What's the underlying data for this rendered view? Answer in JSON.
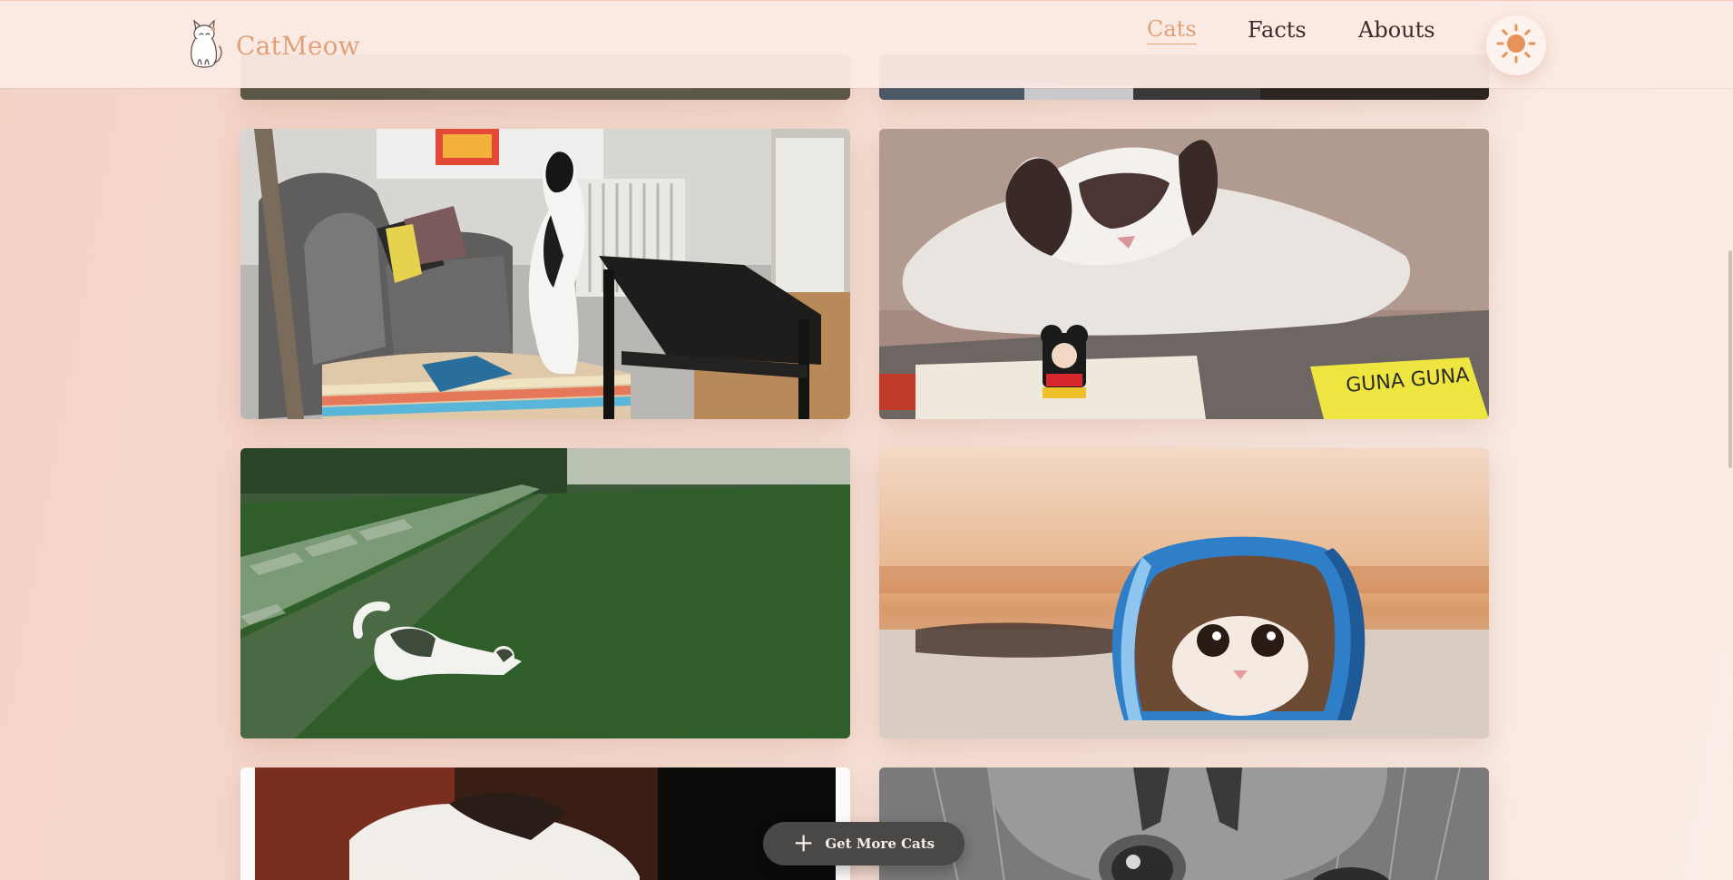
{
  "brand": {
    "name": "CatMeow",
    "logo_icon": "cat-icon"
  },
  "nav": {
    "items": [
      {
        "label": "Cats",
        "active": true
      },
      {
        "label": "Facts",
        "active": false
      },
      {
        "label": "Abouts",
        "active": false
      }
    ]
  },
  "theme_toggle": {
    "icon": "sun-icon"
  },
  "gallery": {
    "photos": [
      {
        "subject": "cat-photo"
      },
      {
        "subject": "cat-photo"
      },
      {
        "subject": "cat-standing-in-living-room"
      },
      {
        "subject": "fluffy-cat-lying-on-table"
      },
      {
        "subject": "cat-stretching-on-grass"
      },
      {
        "subject": "kitten-in-blue-bag"
      },
      {
        "subject": "cat-paws-photo"
      },
      {
        "subject": "grayscale-kitten-closeup"
      }
    ],
    "book_text": "GUNA GUNA"
  },
  "actions": {
    "get_more_label": "Get More Cats",
    "get_more_icon": "plus-icon"
  },
  "colors": {
    "accent": "#e0a178",
    "button_bg": "#4a4846",
    "nav_text": "#3a2d28"
  }
}
